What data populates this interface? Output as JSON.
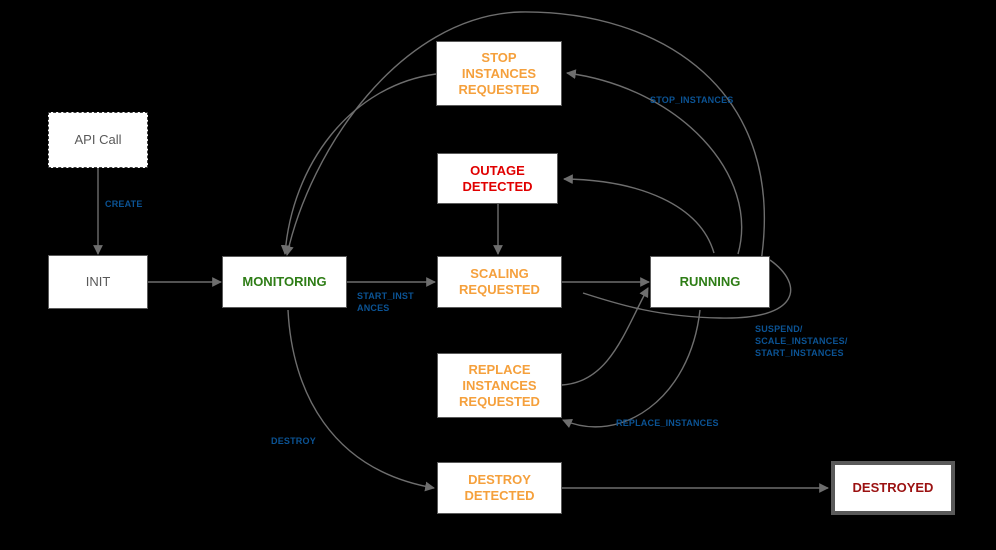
{
  "diagram": {
    "title": "Instance Refresh State Machine",
    "background_color": "#000000",
    "colors": {
      "edge": "#6E6E6E",
      "label": "#0B5394",
      "green": "#2E7D16",
      "orange": "#F5A03C",
      "red": "#E00000",
      "terminal_red": "#9B1111",
      "plain": "#595959",
      "box_fill": "#FFFFFF",
      "box_border": "#5A5A5A"
    }
  },
  "nodes": [
    {
      "id": "api_call",
      "label": "API Call",
      "style": "dashed"
    },
    {
      "id": "init",
      "label": "INIT",
      "style": "plain"
    },
    {
      "id": "monitoring",
      "label": "MONITORING",
      "style": "green"
    },
    {
      "id": "stop_instances",
      "label": "STOP\nINSTANCES\nREQUESTED",
      "style": "orange"
    },
    {
      "id": "outage_detected",
      "label": "OUTAGE\nDETECTED",
      "style": "red"
    },
    {
      "id": "scaling_requested",
      "label": "SCALING\nREQUESTED",
      "style": "orange"
    },
    {
      "id": "running",
      "label": "RUNNING",
      "style": "green"
    },
    {
      "id": "replace_instances",
      "label": "REPLACE\nINSTANCES\nREQUESTED",
      "style": "orange"
    },
    {
      "id": "destroy_detected",
      "label": "DESTROY\nDETECTED",
      "style": "orange"
    },
    {
      "id": "destroyed",
      "label": "DESTROYED",
      "style": "terminal"
    }
  ],
  "edge_labels": [
    {
      "id": "create",
      "text": "CREATE"
    },
    {
      "id": "start_instances",
      "text": "START_INST\nANCES"
    },
    {
      "id": "stop_instances",
      "text": "STOP_INSTANCES"
    },
    {
      "id": "suspend_group",
      "text": "SUSPEND/\nSCALE_INSTANCES/\nSTART_INSTANCES"
    },
    {
      "id": "replace_instances",
      "text": "REPLACE_INSTANCES"
    },
    {
      "id": "destroy",
      "text": "DESTROY"
    }
  ],
  "transitions": [
    {
      "from": "api_call",
      "to": "init",
      "label": "CREATE"
    },
    {
      "from": "init",
      "to": "monitoring",
      "label": ""
    },
    {
      "from": "monitoring",
      "to": "scaling_requested",
      "label": "START_INSTANCES"
    },
    {
      "from": "monitoring",
      "to": "destroy_detected",
      "label": "DESTROY"
    },
    {
      "from": "scaling_requested",
      "to": "running",
      "label": ""
    },
    {
      "from": "running",
      "to": "stop_instances",
      "label": "STOP_INSTANCES"
    },
    {
      "from": "stop_instances",
      "to": "monitoring",
      "label": ""
    },
    {
      "from": "running",
      "to": "outage_detected",
      "label": ""
    },
    {
      "from": "outage_detected",
      "to": "scaling_requested",
      "label": ""
    },
    {
      "from": "running",
      "to": "replace_instances",
      "label": "REPLACE_INSTANCES"
    },
    {
      "from": "replace_instances",
      "to": "running",
      "label": ""
    },
    {
      "from": "running",
      "to": "running",
      "label": "SUSPEND/SCALE_INSTANCES/START_INSTANCES"
    },
    {
      "from": "running",
      "to": "monitoring",
      "label": ""
    },
    {
      "from": "destroy_detected",
      "to": "destroyed",
      "label": ""
    }
  ]
}
